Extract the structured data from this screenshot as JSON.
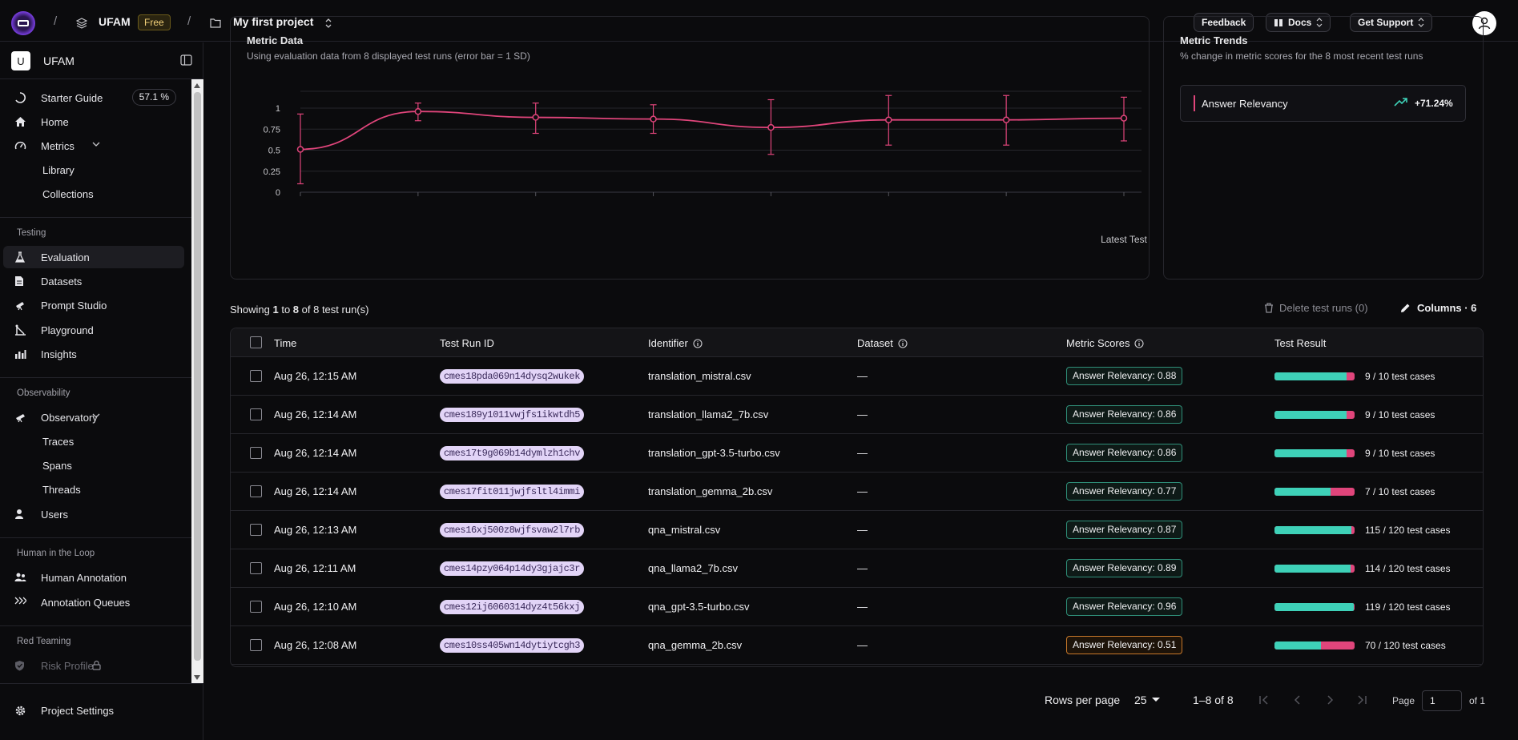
{
  "topbar": {
    "sep1": "/",
    "org": "UFAM",
    "plan": "Free",
    "sep2": "/",
    "project": "My first project",
    "feedback": "Feedback",
    "docs": "Docs",
    "support": "Get Support"
  },
  "sidebar": {
    "org_initial": "U",
    "org_name": "UFAM",
    "starter_guide": "Starter Guide",
    "starter_pct": "57.1 %",
    "home": "Home",
    "metrics": "Metrics",
    "library": "Library",
    "collections": "Collections",
    "sec_testing": "Testing",
    "evaluation": "Evaluation",
    "datasets": "Datasets",
    "prompt_studio": "Prompt Studio",
    "playground": "Playground",
    "insights": "Insights",
    "sec_observability": "Observability",
    "observatory": "Observatory",
    "traces": "Traces",
    "spans": "Spans",
    "threads": "Threads",
    "users": "Users",
    "sec_hitl": "Human in the Loop",
    "human_annotation": "Human Annotation",
    "annotation_queues": "Annotation Queues",
    "sec_red": "Red Teaming",
    "risk_profile": "Risk Profile",
    "project_settings": "Project Settings"
  },
  "chart_panel": {
    "title": "Metric Data",
    "subtitle": "Using evaluation data from 8 displayed test runs (error bar = 1 SD)"
  },
  "chart_data": {
    "type": "line",
    "x": [
      1,
      2,
      3,
      4,
      5,
      6,
      7,
      8
    ],
    "series": [
      {
        "values": [
          0.51,
          0.96,
          0.89,
          0.87,
          0.77,
          0.86,
          0.86,
          0.88
        ],
        "err_low": [
          0.1,
          0.85,
          0.7,
          0.7,
          0.45,
          0.56,
          0.56,
          0.61
        ],
        "err_high": [
          0.93,
          1.06,
          1.06,
          1.04,
          1.1,
          1.15,
          1.15,
          1.13
        ],
        "color": "#e0457b"
      }
    ],
    "yticks": [
      "0",
      "0.25",
      "0.5",
      "0.75",
      "1"
    ],
    "ylim": [
      0,
      1.2
    ],
    "xlabel": "Latest Test",
    "grid": true
  },
  "trend_panel": {
    "title": "Metric Trends",
    "subtitle": "% change in metric scores for the 8 most recent test runs",
    "metric": "Answer Relevancy",
    "change": "+71.24%"
  },
  "table_bar": {
    "showing_prefix": "Showing ",
    "showing_from": "1",
    "showing_to_word": " to ",
    "showing_to": "8",
    "showing_of": " of 8 test run(s)",
    "delete": "Delete test runs (0)",
    "columns": "Columns · 6"
  },
  "table": {
    "headers": {
      "time": "Time",
      "run_id": "Test Run ID",
      "identifier": "Identifier",
      "dataset": "Dataset",
      "scores": "Metric Scores",
      "result": "Test Result"
    },
    "rows": [
      {
        "time": "Aug 26, 12:15 AM",
        "run_id": "cmes18pda069n14dysq2wukek",
        "identifier": "translation_mistral.csv",
        "dataset": "—",
        "score": "Answer Relevancy: 0.88",
        "passed": 9,
        "total": 10,
        "result": "9 / 10 test cases"
      },
      {
        "time": "Aug 26, 12:14 AM",
        "run_id": "cmes189y1011vwjfs1ikwtdh5",
        "identifier": "translation_llama2_7b.csv",
        "dataset": "—",
        "score": "Answer Relevancy: 0.86",
        "passed": 9,
        "total": 10,
        "result": "9 / 10 test cases"
      },
      {
        "time": "Aug 26, 12:14 AM",
        "run_id": "cmes17t9g069b14dymlzh1chv",
        "identifier": "translation_gpt-3.5-turbo.csv",
        "dataset": "—",
        "score": "Answer Relevancy: 0.86",
        "passed": 9,
        "total": 10,
        "result": "9 / 10 test cases"
      },
      {
        "time": "Aug 26, 12:14 AM",
        "run_id": "cmes17fit011jwjfsltl4immi",
        "identifier": "translation_gemma_2b.csv",
        "dataset": "—",
        "score": "Answer Relevancy: 0.77",
        "passed": 7,
        "total": 10,
        "result": "7 / 10 test cases"
      },
      {
        "time": "Aug 26, 12:13 AM",
        "run_id": "cmes16xj500z8wjfsvaw2l7rb",
        "identifier": "qna_mistral.csv",
        "dataset": "—",
        "score": "Answer Relevancy: 0.87",
        "passed": 115,
        "total": 120,
        "result": "115 / 120 test cases"
      },
      {
        "time": "Aug 26, 12:11 AM",
        "run_id": "cmes14pzy064p14dy3gjajc3r",
        "identifier": "qna_llama2_7b.csv",
        "dataset": "—",
        "score": "Answer Relevancy: 0.89",
        "passed": 114,
        "total": 120,
        "result": "114 / 120 test cases"
      },
      {
        "time": "Aug 26, 12:10 AM",
        "run_id": "cmes12ij6060314dyz4t56kxj",
        "identifier": "qna_gpt-3.5-turbo.csv",
        "dataset": "—",
        "score": "Answer Relevancy: 0.96",
        "passed": 119,
        "total": 120,
        "result": "119 / 120 test cases"
      },
      {
        "time": "Aug 26, 12:08 AM",
        "run_id": "cmes10ss405wn14dytiytcgh3",
        "identifier": "qna_gemma_2b.csv",
        "dataset": "—",
        "score": "Answer Relevancy: 0.51",
        "passed": 70,
        "total": 120,
        "result": "70 / 120 test cases",
        "warn": true
      }
    ]
  },
  "pagination": {
    "rows_per_page": "Rows per page",
    "rows_value": "25",
    "range": "1–8 of 8",
    "page_label": "Page",
    "page_value": "1",
    "page_of": "of 1"
  },
  "colors": {
    "accent": "#e0457b",
    "pass": "#3ed1b8",
    "score_border": "#2f8f79",
    "warn_border": "#c8782a",
    "runid_bg": "#e2d4f7"
  }
}
